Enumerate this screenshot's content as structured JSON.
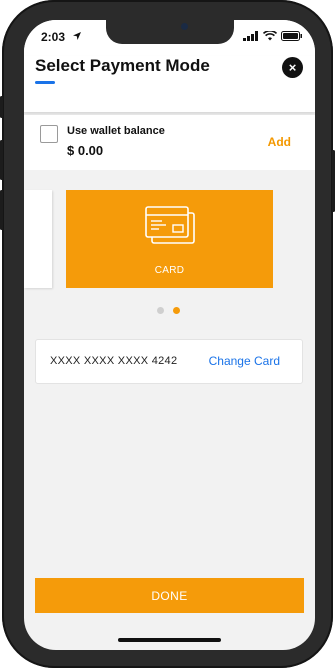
{
  "status_bar": {
    "time": "2:03",
    "icons": [
      "location-arrow-icon",
      "signal-icon",
      "wifi-icon",
      "battery-icon"
    ]
  },
  "header": {
    "title": "Select Payment Mode",
    "close_icon": "×"
  },
  "wallet": {
    "label": "Use wallet balance",
    "amount": "$ 0.00",
    "add_label": "Add",
    "checked": false
  },
  "payment_methods": {
    "card_label": "CARD",
    "current_page": 2,
    "total_pages": 2
  },
  "saved_card": {
    "masked_number": "XXXX XXXX XXXX 4242",
    "change_label": "Change Card"
  },
  "footer": {
    "done_label": "DONE"
  },
  "colors": {
    "accent": "#f59b0a",
    "link": "#1a73e8",
    "background": "#f2f2f2"
  }
}
